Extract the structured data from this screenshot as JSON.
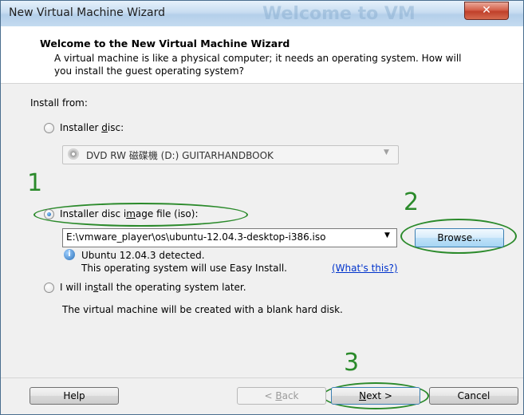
{
  "window": {
    "title": "New Virtual Machine Wizard",
    "title_ghost": "Welcome to VM",
    "close_glyph": "✕"
  },
  "header": {
    "title": "Welcome to the New Virtual Machine Wizard",
    "description": "A virtual machine is like a physical computer; it needs an operating system. How will you install the guest operating system?"
  },
  "install_from": {
    "label": "Install from:",
    "installer_disc": {
      "label": "Installer disc:",
      "selected": false,
      "drive_value": "DVD RW 磁碟機 (D:) GUITARHANDBOOK",
      "icon": "disc-icon"
    },
    "iso": {
      "label": "Installer disc image file (iso):",
      "selected": true,
      "path_value": "E:\\vmware_player\\os\\ubuntu-12.04.3-desktop-i386.iso",
      "browse_label": "Browse...",
      "detected_line": "Ubuntu 12.04.3 detected.",
      "easy_install_line": "This operating system will use Easy Install.",
      "whats_this": "(What's this?)",
      "info_icon": "info-icon"
    },
    "later": {
      "label": "I will install the operating system later.",
      "selected": false,
      "note": "The virtual machine will be created with a blank hard disk."
    }
  },
  "footer": {
    "help": "Help",
    "back": "< Back",
    "next": "Next >",
    "cancel": "Cancel"
  },
  "annotations": {
    "step1": "1",
    "step2": "2",
    "step3": "3",
    "color": "#2b8a2b"
  }
}
